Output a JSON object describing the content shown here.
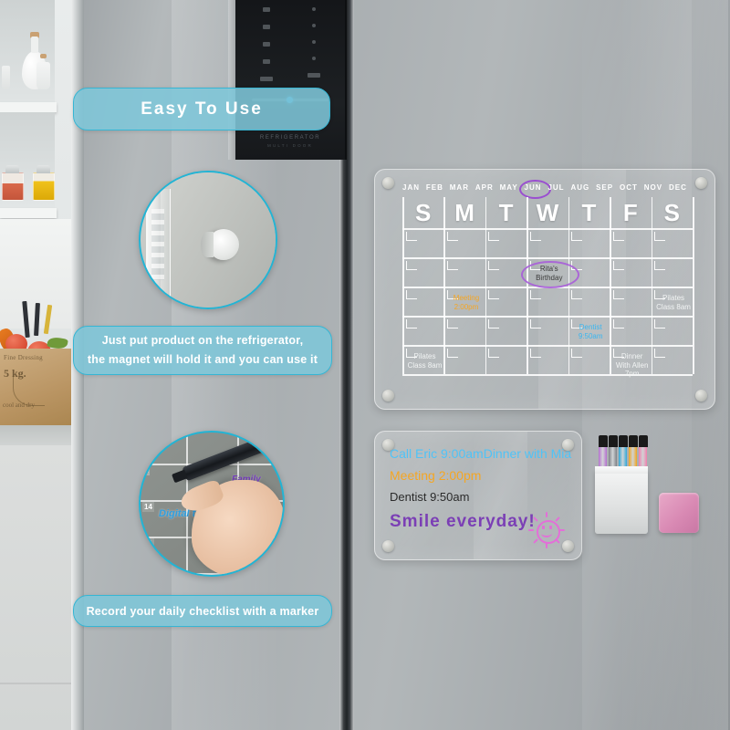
{
  "banners": {
    "easy": "Easy To Use",
    "magnet_line1": "Just put product on the refrigerator,",
    "magnet_line2": "the magnet will hold it and you can use it",
    "record": "Record your daily checklist with a marker"
  },
  "colors": {
    "accent_teal": "#7ec6d8",
    "accent_border": "#36b6d4",
    "ink_orange": "#f5a623",
    "ink_blue": "#3ab6f0",
    "ink_purple": "#7b3fb5",
    "circle_purple": "#a85fd8",
    "sun_pink": "#e36fd8",
    "eraser_pink": "#d98ab4"
  },
  "calendar": {
    "months": [
      "JAN",
      "FEB",
      "MAR",
      "APR",
      "MAY",
      "JUN",
      "JUL",
      "AUG",
      "SEP",
      "OCT",
      "NOV",
      "DEC"
    ],
    "selected_month": "JUN",
    "days_of_week": [
      "S",
      "M",
      "T",
      "W",
      "T",
      "F",
      "S"
    ],
    "weeks": 5,
    "events": [
      {
        "text": "Rita's Birthday",
        "row": 1,
        "col": 3,
        "color": "dark",
        "circled": true
      },
      {
        "text": "Meeting 2:00pm",
        "row": 2,
        "col": 1,
        "color": "orange",
        "circled": false
      },
      {
        "text": "Pilates Class 8am",
        "row": 2,
        "col": 6,
        "color": "white",
        "circled": false
      },
      {
        "text": "Dentist 9:50am",
        "row": 3,
        "col": 4,
        "color": "blue",
        "circled": false
      },
      {
        "text": "Pilates Class 8am",
        "row": 4,
        "col": 0,
        "color": "white",
        "circled": false
      },
      {
        "text": "Dinner With Allen 7pm",
        "row": 4,
        "col": 5,
        "color": "white",
        "circled": false
      }
    ]
  },
  "notes": {
    "line1": "Call Eric 9:00amDinner with Mia",
    "line2": "Meeting 2:00pm",
    "line3": "Dentist 9:50am",
    "line4": "Smile everyday!",
    "doodle": "sun-doodle"
  },
  "markers": {
    "count": 5,
    "colors": [
      "#b56fd0",
      "#7c8086",
      "#2fa8d8",
      "#f0a51e",
      "#f07fae"
    ],
    "holder": "marker-holder",
    "eraser": "eraser-block"
  },
  "insets": {
    "magnet_closeup": "magnet-closeup-photo",
    "writing_closeup": "hand-writing-closeup-photo",
    "writing_ink_blue": "Digital training",
    "writing_ink_purple": "Family"
  },
  "fridge": {
    "panel_brand": "REFRIGERATOR",
    "panel_brand_sub": "MULTI DOOR"
  },
  "kitchen": {
    "sack_text_top": "Fine Dressing",
    "sack_text_mid": "5 kg.",
    "sack_text_bottom": "cool and dry"
  }
}
